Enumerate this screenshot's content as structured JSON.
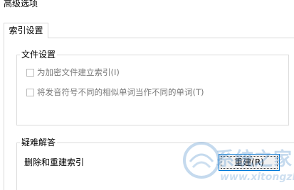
{
  "window": {
    "title": "高级选项"
  },
  "tabs": [
    {
      "label": "索引设置",
      "selected": true
    }
  ],
  "file_settings": {
    "legend": "文件设置",
    "options": [
      {
        "label": "为加密文件建立索引(I)",
        "checked": false,
        "enabled": false
      },
      {
        "label": "将发音符号不同的相似单词当作不同的单词(T)",
        "checked": false,
        "enabled": false
      }
    ]
  },
  "troubleshooting": {
    "legend": "疑难解答",
    "rebuild_label": "删除和重建索引",
    "rebuild_button_label": "重建(R)"
  },
  "watermark": {
    "text": "系统之家",
    "sub": "www.xitongzhijia.net"
  },
  "colors": {
    "focus_border": "#0078d7",
    "disabled_text": "#7a7a7a",
    "group_border": "#dcdcdc"
  }
}
